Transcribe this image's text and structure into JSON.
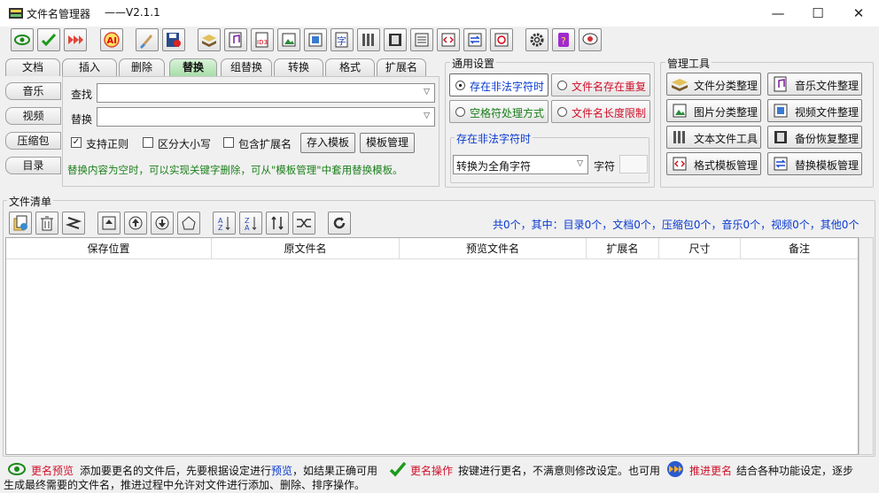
{
  "window": {
    "title": "文件名管理器",
    "version": "——V2.1.1",
    "minimize": "—",
    "maximize": "☐",
    "close": "✕"
  },
  "tabs": [
    "文档",
    "插入",
    "删除",
    "替换",
    "组替换",
    "转换",
    "格式",
    "扩展名"
  ],
  "active_tab": "替换",
  "side_tabs": [
    "音乐",
    "视频",
    "压缩包",
    "目录"
  ],
  "replace_panel": {
    "find_label": "查找",
    "find_value": "",
    "replace_label": "替换",
    "replace_value": "",
    "opt_regex": "支持正则",
    "opt_regex_checked": true,
    "opt_case": "区分大小写",
    "opt_case_checked": false,
    "opt_ext": "包含扩展名",
    "opt_ext_checked": false,
    "save_template": "存入模板",
    "manage_template": "模板管理",
    "hint": "替换内容为空时，可以实现关键字删除，可从\"模板管理\"中套用替换模板。"
  },
  "settings": {
    "title": "通用设置",
    "opt_illegal": "存在非法字符时",
    "opt_exists": "文件名存在重复",
    "opt_space": "空格符处理方式",
    "opt_length": "文件名长度限制",
    "sub_title": "存在非法字符时",
    "convert_select": "转换为全角字符",
    "char_label": "字符",
    "char_value": ""
  },
  "tools": {
    "title": "管理工具",
    "items": [
      "文件分类整理",
      "音乐文件整理",
      "图片分类整理",
      "视频文件整理",
      "文本文件工具",
      "备份恢复整理",
      "格式模板管理",
      "替换模板管理"
    ]
  },
  "file_list": {
    "title": "文件清单",
    "summary": "共0个，其中：目录0个，文档0个，压缩包0个，音乐0个，视频0个，其他0个",
    "columns": [
      "保存位置",
      "原文件名",
      "预览文件名",
      "扩展名",
      "尺寸",
      "备注"
    ]
  },
  "status": {
    "preview_label": "更名预览",
    "text1": "添加要更名的文件后，先要根据设定进行",
    "preview_link": "预览",
    "text2": "，如结果正确可用",
    "rename_label": "更名操作",
    "text3": "按键进行更名，不满意则修改设定。也可用",
    "advance_label": "推进更名",
    "text4": "结合各种功能设定，逐步",
    "text5": "生成最终需要的文件名，推进过程中允许对文件进行添加、删除、排序操作。"
  },
  "colors": {
    "accent_green": "#1a7f1a",
    "accent_blue": "#0a3ad0",
    "accent_red": "#d0102a",
    "active_tab": "#a6dca6"
  },
  "toolbar_icons": [
    "preview-icon",
    "rename-icon",
    "advance-icon",
    "ai-icon",
    "clean-icon",
    "save-icon",
    "books-icon",
    "music-icon",
    "id3-icon",
    "image-icon",
    "photo-icon",
    "text-icon",
    "folder-icon",
    "film-icon",
    "notes-icon",
    "code-icon",
    "swap-icon",
    "refresh-icon",
    "gear-icon",
    "help-icon",
    "chat-icon"
  ]
}
